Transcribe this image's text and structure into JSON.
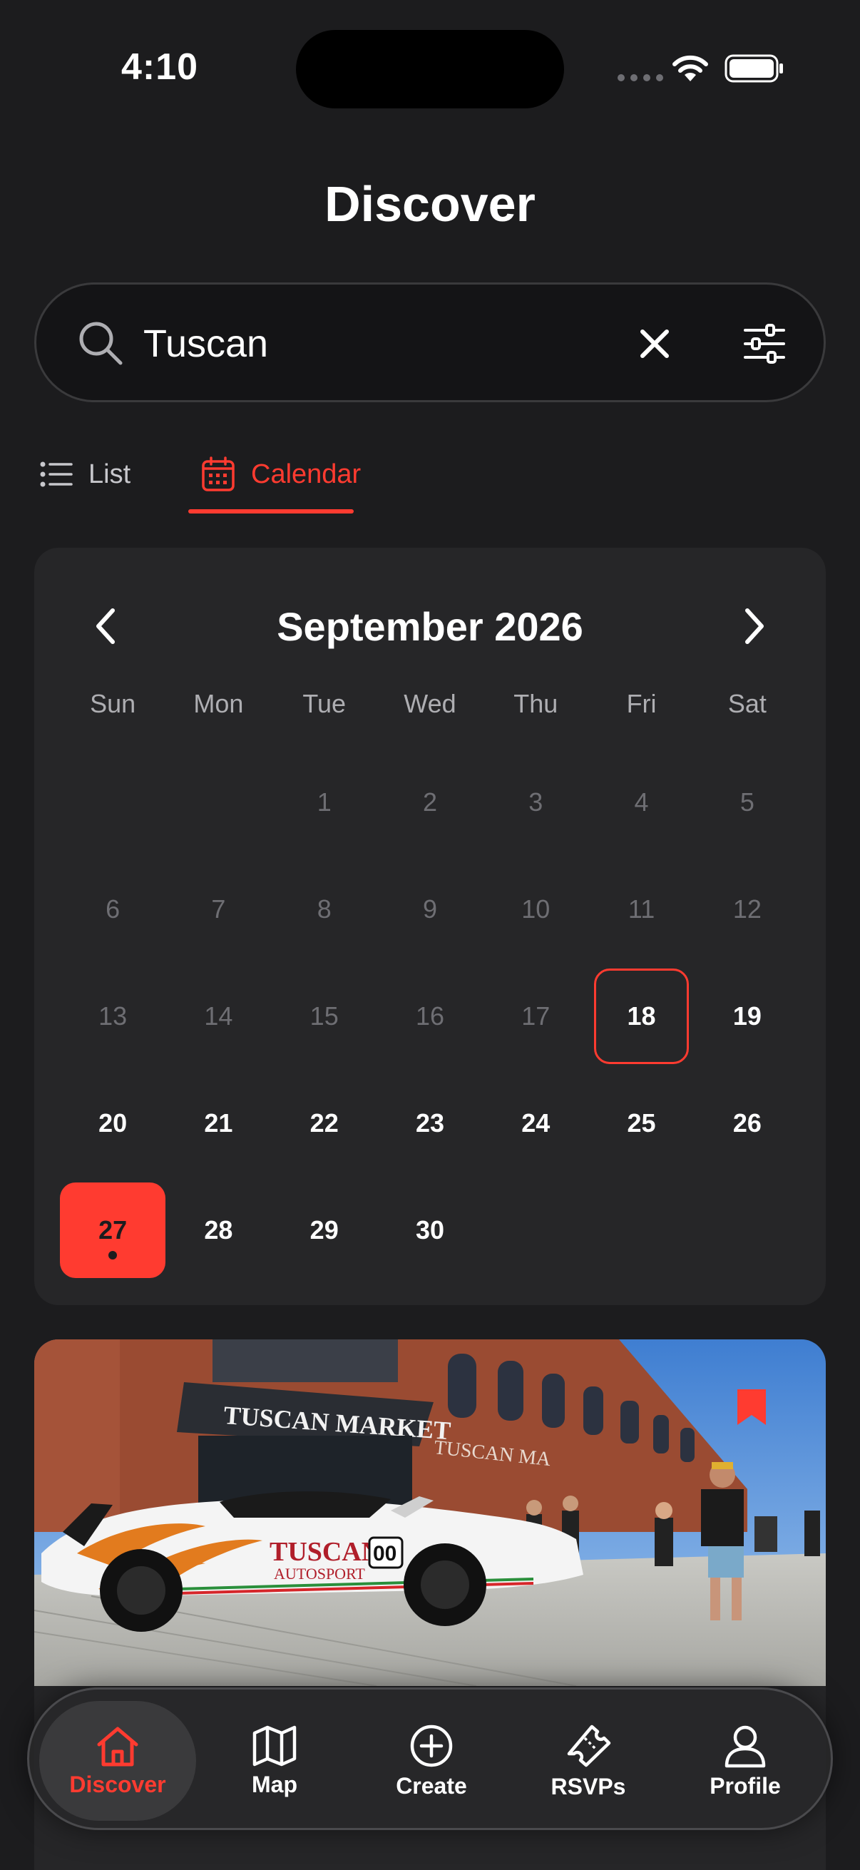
{
  "status_bar": {
    "time": "4:10"
  },
  "header": {
    "title": "Discover"
  },
  "search": {
    "value": "Tuscan"
  },
  "view_tabs": [
    {
      "label": "List",
      "active": false
    },
    {
      "label": "Calendar",
      "active": true
    }
  ],
  "calendar": {
    "month_label": "September 2026",
    "weekdays": [
      "Sun",
      "Mon",
      "Tue",
      "Wed",
      "Thu",
      "Fri",
      "Sat"
    ],
    "days": [
      "1",
      "2",
      "3",
      "4",
      "5",
      "6",
      "7",
      "8",
      "9",
      "10",
      "11",
      "12",
      "13",
      "14",
      "15",
      "16",
      "17",
      "18",
      "19",
      "20",
      "21",
      "22",
      "23",
      "24",
      "25",
      "26",
      "27",
      "28",
      "29",
      "30"
    ],
    "today": "18",
    "selected": "27",
    "days_with_events": [
      "27"
    ]
  },
  "event_card": {
    "image_text": {
      "building_sign": "TUSCAN MARKET",
      "building_sign_2": "TUSCAN MA",
      "car_brand_line1": "TUSCAN",
      "car_brand_line2": "AUTOSPORT",
      "car_number": "00"
    },
    "bookmarked": true
  },
  "tab_bar": [
    {
      "label": "Discover",
      "icon": "house-icon",
      "active": true
    },
    {
      "label": "Map",
      "icon": "map-icon",
      "active": false
    },
    {
      "label": "Create",
      "icon": "plus-circle-icon",
      "active": false
    },
    {
      "label": "RSVPs",
      "icon": "ticket-icon",
      "active": false
    },
    {
      "label": "Profile",
      "icon": "person-icon",
      "active": false
    }
  ],
  "colors": {
    "accent": "#ff3b30",
    "background": "#1c1c1e",
    "card": "#262628"
  }
}
